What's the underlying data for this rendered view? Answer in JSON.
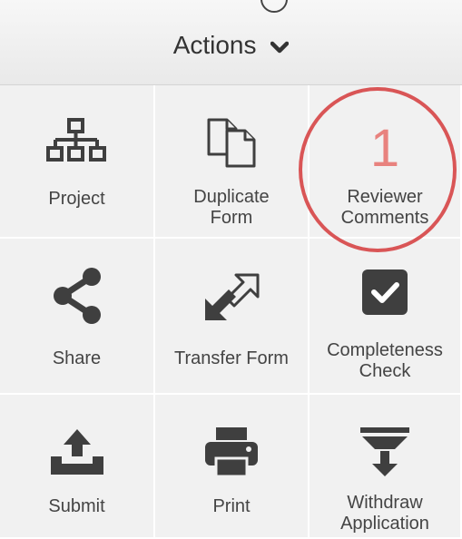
{
  "header": {
    "title": "Actions",
    "chevron_icon": "chevron-down-icon"
  },
  "colors": {
    "tile_bg": "#f1f1f1",
    "icon": "#3f3f3f",
    "count": "#e8827e",
    "highlight_ring": "#d95556"
  },
  "actions": [
    {
      "label": "Project",
      "icon": "org-chart-icon"
    },
    {
      "label": "Duplicate\nForm",
      "icon": "duplicate-icon"
    },
    {
      "label": "Reviewer\nComments",
      "count": "1"
    },
    {
      "label": "Share",
      "icon": "share-icon"
    },
    {
      "label": "Transfer Form",
      "icon": "transfer-icon"
    },
    {
      "label": "Completeness\nCheck",
      "icon": "checkbox-icon"
    },
    {
      "label": "Submit",
      "icon": "upload-icon"
    },
    {
      "label": "Print",
      "icon": "printer-icon"
    },
    {
      "label": "Withdraw\nApplication",
      "icon": "withdraw-icon"
    }
  ]
}
